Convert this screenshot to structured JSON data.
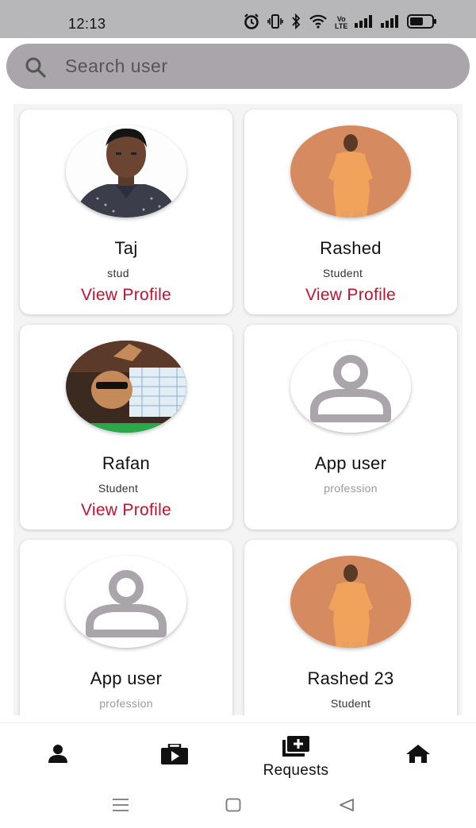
{
  "status_bar": {
    "time": "12:13",
    "icons": [
      "alarm-icon",
      "vibrate-icon",
      "bluetooth-icon",
      "wifi-icon",
      "volte-icon",
      "signal-icon",
      "signal-icon",
      "battery-icon"
    ],
    "volte_text_top": "Vo",
    "volte_text_bottom": "LTE"
  },
  "search": {
    "placeholder": "Search user",
    "value": ""
  },
  "users": [
    {
      "name": "Taj",
      "profession": "stud",
      "action": "View Profile",
      "avatar": "photo-man-dark-shirt"
    },
    {
      "name": "Rashed",
      "profession": "Student",
      "action": "View Profile",
      "avatar": "photo-man-orange-kurta"
    },
    {
      "name": "Rafan",
      "profession": "Student",
      "action": "View Profile",
      "avatar": "photo-man-sunglasses"
    },
    {
      "name": "App user",
      "profession": "profession",
      "action": "",
      "avatar": "default-person-icon"
    },
    {
      "name": "App user",
      "profession": "profession",
      "action": "",
      "avatar": "default-person-icon"
    },
    {
      "name": "Rashed 23",
      "profession": "Student",
      "action": "",
      "avatar": "photo-man-orange-kurta"
    }
  ],
  "bottom_nav": {
    "items": [
      {
        "icon": "person-icon",
        "label": ""
      },
      {
        "icon": "video-library-icon",
        "label": ""
      },
      {
        "icon": "add-to-queue-icon",
        "label": "Requests"
      },
      {
        "icon": "home-icon",
        "label": ""
      }
    ]
  },
  "system_nav": [
    "menu-icon",
    "home-square-icon",
    "back-triangle-icon"
  ],
  "colors": {
    "status_bar_bg": "#b7b7b9",
    "search_bg": "#a9a5aa",
    "link": "#c8102e",
    "grid_bg": "#f4f4f4"
  }
}
